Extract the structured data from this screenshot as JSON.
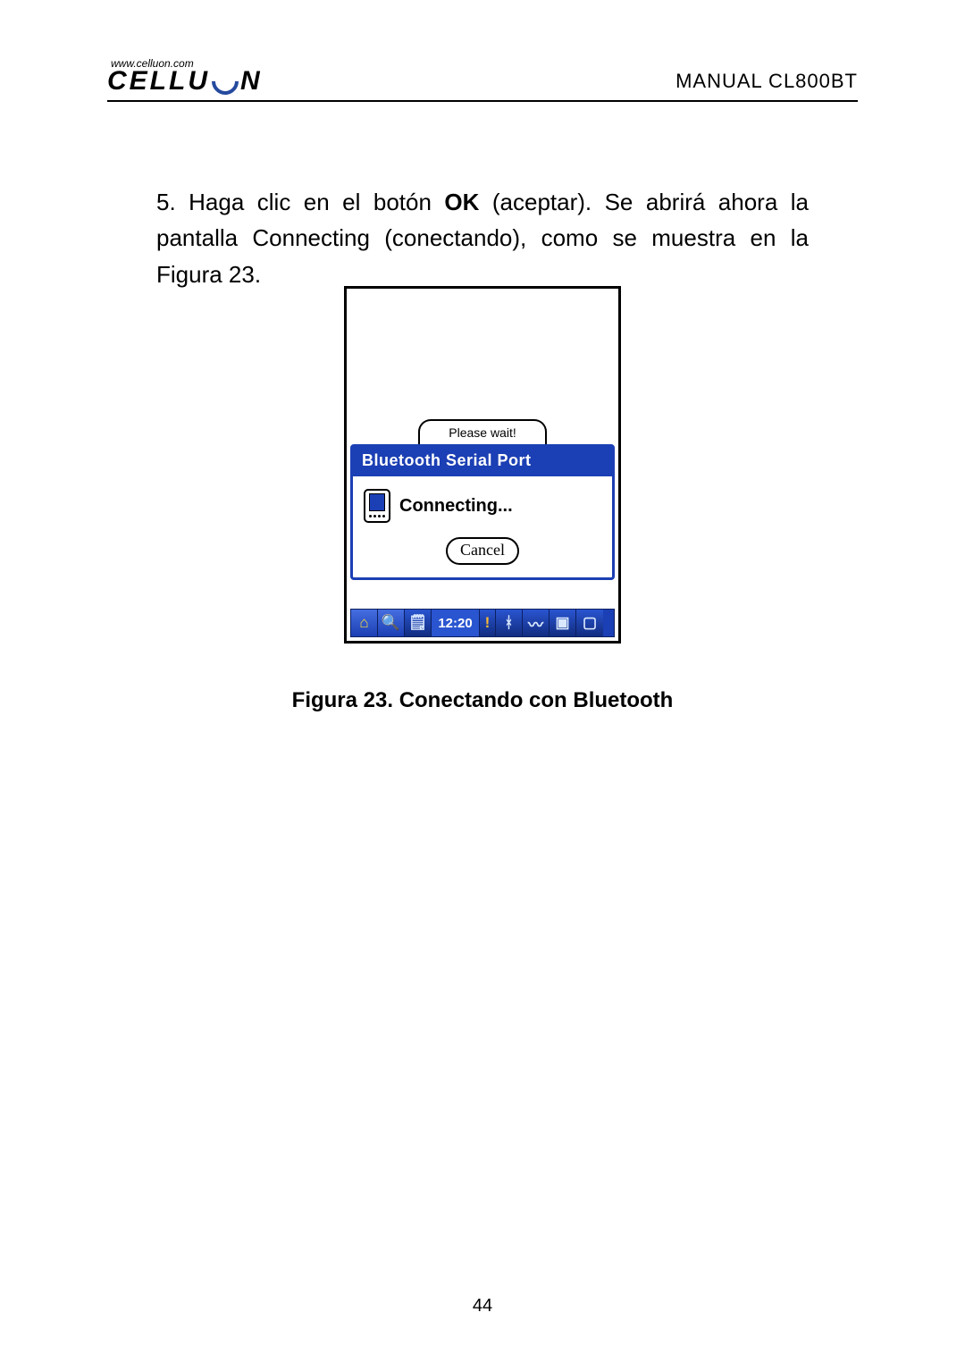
{
  "header": {
    "logo_url": "www.celluon.com",
    "logo_text_left": "CELLU",
    "logo_text_right": "N",
    "manual_title": "MANUAL CL800BT"
  },
  "body": {
    "step_num": "5.",
    "line1a": " Haga clic en el botón ",
    "line1b": "OK",
    "line1c": " (aceptar). Se abrirá ahora la pantalla Connecting (conectando), como se muestra en la Figura 23."
  },
  "figure": {
    "bg_dialog_text": "Please wait!",
    "dialog_title": "Bluetooth Serial Port",
    "connecting_label": "Connecting...",
    "cancel_label": "Cancel",
    "clock": "12:20",
    "caption": "Figura 23. Conectando con Bluetooth"
  },
  "page_number": "44"
}
